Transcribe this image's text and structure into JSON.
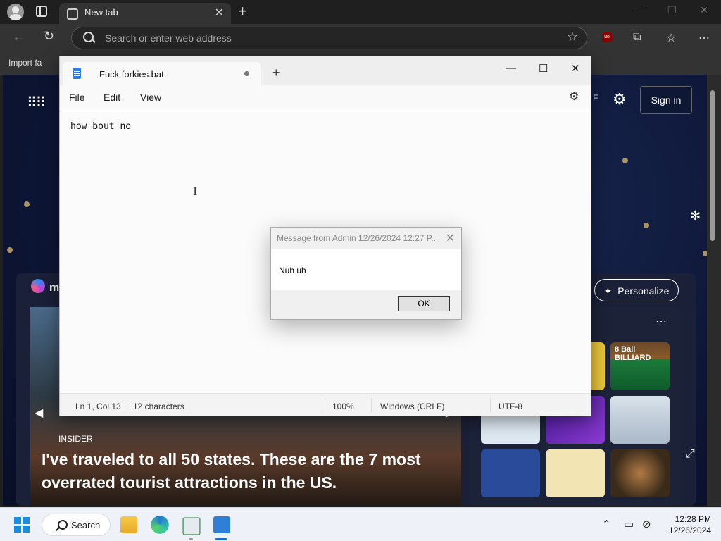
{
  "browser": {
    "tab_title": "New tab",
    "address_placeholder": "Search or enter web address",
    "favorites_item": "Import fa"
  },
  "ntp": {
    "sign_in": "Sign in",
    "personalize": "Personalize",
    "brand_letter": "m",
    "news": {
      "source": "INSIDER",
      "headline": "I've traveled to all 50 states. These are the 7 most overrated tourist attractions in the US."
    },
    "games": [
      {
        "name": "8 Ball Billiard",
        "label": "8 Ball BILLIARD"
      }
    ]
  },
  "notepad": {
    "file_title": "Fuck forkies.bat",
    "menu": [
      "File",
      "Edit",
      "View"
    ],
    "content": "how bout no",
    "status": {
      "position": "Ln 1, Col 13",
      "chars": "12 characters",
      "zoom": "100%",
      "line_ending": "Windows (CRLF)",
      "encoding": "UTF-8"
    }
  },
  "dialog": {
    "title": "Message from Admin 12/26/2024 12:27 P...",
    "message": "Nuh uh",
    "ok_label": "OK"
  },
  "taskbar": {
    "search_label": "Search",
    "time": "12:28 PM",
    "date": "12/26/2024"
  }
}
